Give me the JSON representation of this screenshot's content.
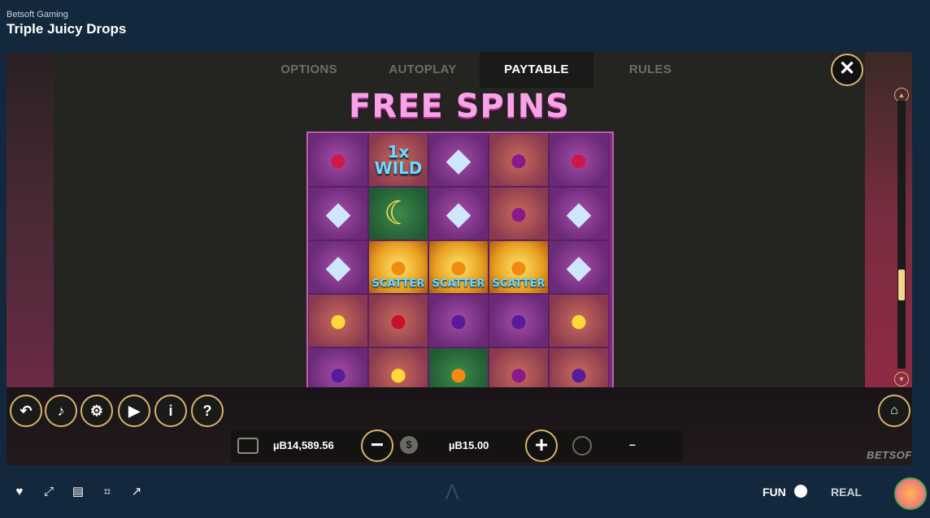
{
  "header": {
    "provider": "Betsoft Gaming",
    "title": "Triple Juicy Drops"
  },
  "tabs": [
    {
      "label": "OPTIONS"
    },
    {
      "label": "AUTOPLAY"
    },
    {
      "label": "PAYTABLE"
    },
    {
      "label": "RULES"
    }
  ],
  "active_tab": "PAYTABLE",
  "paytable": {
    "section_title": "FREE SPINS",
    "wild_label": "1x WILD",
    "scatter_labels": [
      "SCATTER",
      "SCATTER",
      "SCATTER"
    ]
  },
  "controls": {
    "balance": "µB14,589.56",
    "bet": "µB15.00",
    "win": "–",
    "brand": "BETSOFT"
  },
  "toolbar": {
    "fun_label": "FUN",
    "real_label": "REAL"
  },
  "icons": [
    "back-icon",
    "sound-icon",
    "settings-icon",
    "autoplay-icon",
    "info-icon",
    "help-icon",
    "close-icon",
    "home-icon",
    "wallet-icon",
    "coins-icon",
    "award-icon",
    "heart-icon",
    "expand-icon",
    "layout-icon",
    "screenshot-icon",
    "external-link-icon"
  ],
  "colors": {
    "accent": "#d6b46a",
    "title_pink": "#f7a4e6",
    "scatter_blue": "#6fd8ff",
    "background": "#13283d"
  }
}
